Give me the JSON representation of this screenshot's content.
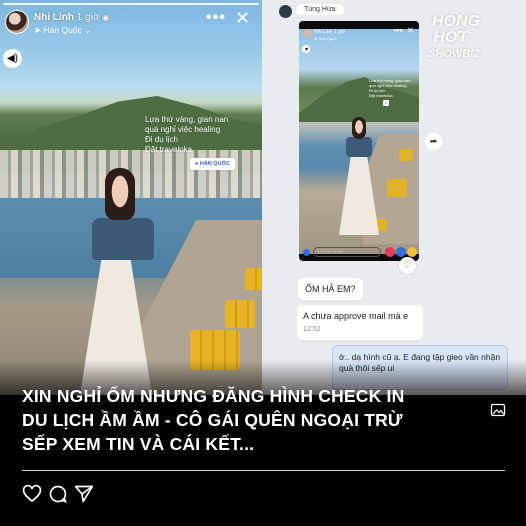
{
  "story": {
    "username": "Nhi Linh",
    "time": "1 giờ",
    "location": "Hàn Quốc",
    "caption_lines": [
      "Lựa thứ vàng, gian nan",
      "quá nghỉ việc healing",
      "Đi du lịch",
      "Đặt traveloka"
    ],
    "location_sticker": "HÀN QUỐC"
  },
  "chat": {
    "contact_name": "Tùng Hứa",
    "brand_lines": [
      "HÓNG",
      "HỚT",
      "SHOWBIZ"
    ],
    "mini_story": {
      "username": "Nhi Linh",
      "time": "1 giờ",
      "location": "Hàn Quốc",
      "caption_lines": [
        "Lựa thứ vàng, gian nan",
        "quá nghỉ việc healing",
        "Đi du lịch",
        "Đặt traveloka"
      ],
      "reply_placeholder": "Gửi tin nhắn..."
    },
    "messages": [
      {
        "sender": "other",
        "text": "ỐM HẢ EM?"
      },
      {
        "sender": "other",
        "text": "A chưa approve mail mà e",
        "time": "12:52"
      },
      {
        "sender": "me",
        "text": "ờ.. dạ hình cũ ạ. E đang tập gieo vần nhận quà thôi sếp ui"
      }
    ]
  },
  "post": {
    "headline_lines": [
      "XIN NGHỈ ỐM NHƯNG ĐĂNG HÌNH CHECK IN",
      "DU LỊCH ẦM ẦM - CÔ GÁI QUÊN NGOẠI TRỪ",
      "SẾP XEM TIN VÀ CÁI KẾT..."
    ]
  },
  "icons": {
    "like": "heart-icon",
    "comment": "comment-icon",
    "share": "send-icon",
    "save": "bookmark-icon"
  }
}
